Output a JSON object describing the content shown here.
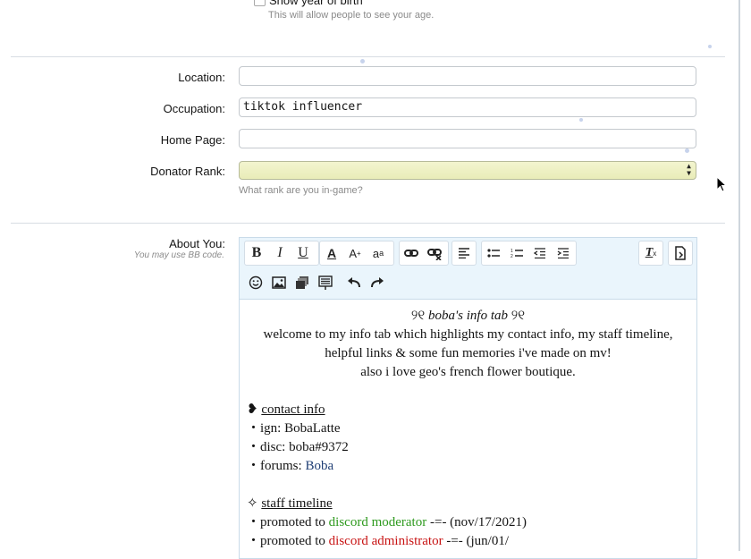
{
  "birth": {
    "checkbox_label": "Show year of birth",
    "hint": "This will allow people to see your age."
  },
  "fields": {
    "location_label": "Location:",
    "location_value": "",
    "occupation_label": "Occupation:",
    "occupation_value": "tiktok influencer",
    "homepage_label": "Home Page:",
    "homepage_value": "",
    "donator_label": "Donator Rank:",
    "donator_value": "",
    "donator_hint": "What rank are you in-game?"
  },
  "about": {
    "label": "About You:",
    "hint": "You may use BB code."
  },
  "toolbar_icons": [
    "bold-icon",
    "italic-icon",
    "underline-icon",
    "font-color-icon",
    "font-size-icon",
    "font-family-icon",
    "link-icon",
    "unlink-icon",
    "align-icon",
    "bullet-list-icon",
    "numbered-list-icon",
    "outdent-icon",
    "indent-icon",
    "remove-format-icon",
    "toggle-bbcode-icon",
    "smilie-icon",
    "image-icon",
    "media-icon",
    "quote-icon",
    "undo-icon",
    "redo-icon"
  ],
  "toolbar_labels": {
    "bold": "B",
    "italic": "I",
    "underline": "U",
    "font_color": "A",
    "font_size": "A",
    "font_family": "a"
  },
  "content": {
    "title_deco": "୨୧",
    "title": "boba's info tab",
    "intro_line1": "welcome to my info tab which highlights my contact info, my staff timeline,",
    "intro_line2": "helpful links & some fun memories i've made on mv!",
    "intro_line3": "also i love geo's french flower boutique.",
    "contact_bullet": "❥",
    "contact_heading": "contact info",
    "contact_items": [
      {
        "text": "ign: BobaLatte"
      },
      {
        "text": "disc: boba#9372"
      },
      {
        "prefix": "forums: ",
        "link": "Boba"
      }
    ],
    "item_bullet": "・",
    "staff_bullet": "✧",
    "staff_heading": "staff timeline",
    "staff_items": [
      {
        "prefix": "promoted to ",
        "role": "discord moderator",
        "role_color": "#2e9a1e",
        "suffix": " -=- (nov/17/2021)"
      },
      {
        "prefix": "promoted to ",
        "role": "discord administrator",
        "role_color": "#c81414",
        "suffix": " -=- (jun/01/"
      }
    ]
  }
}
